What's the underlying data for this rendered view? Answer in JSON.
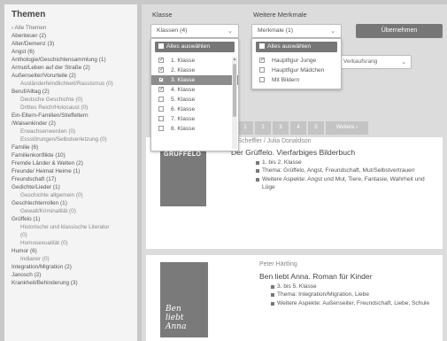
{
  "sidebar": {
    "title": "Themen",
    "items": [
      {
        "label": "› Alle Themen",
        "level": "root"
      },
      {
        "label": "Abenteuer (2)",
        "level": "top"
      },
      {
        "label": "Alter/Demenz (3)",
        "level": "top"
      },
      {
        "label": "Angst (6)",
        "level": "top"
      },
      {
        "label": "Anthologie/Geschichtensammlung (1)",
        "level": "top"
      },
      {
        "label": "Armut/Leben auf der Straße (2)",
        "level": "top"
      },
      {
        "label": "Außenseiter/Vorurteile (2)",
        "level": "top"
      },
      {
        "label": "Ausländerfeindlichkeit/Rassismus (0)",
        "level": "sub"
      },
      {
        "label": "Beruf/Alltag (2)",
        "level": "top"
      },
      {
        "label": "Deutsche Geschichte (0)",
        "level": "sub"
      },
      {
        "label": "Drittes Reich/Holocaust (0)",
        "level": "sub"
      },
      {
        "label": "Ein-Eltern-Familien/Stieffeltern",
        "level": "top"
      },
      {
        "label": "/Waisenkinder (2)",
        "level": "top"
      },
      {
        "label": "Erwachsenwerden (0)",
        "level": "sub"
      },
      {
        "label": "Essstörungen/Selbstverletzung (0)",
        "level": "sub"
      },
      {
        "label": "Familie (6)",
        "level": "top"
      },
      {
        "label": "Familienkonflikte (10)",
        "level": "top"
      },
      {
        "label": "Fremde Länder & Welten (2)",
        "level": "top"
      },
      {
        "label": "Freunde/ Heimat Heime (1)",
        "level": "top"
      },
      {
        "label": "Freundschaft (17)",
        "level": "top"
      },
      {
        "label": "Gedichte/Lieder (1)",
        "level": "top"
      },
      {
        "label": "Geschichte allgemein (0)",
        "level": "sub"
      },
      {
        "label": "Geschlechterrollen (1)",
        "level": "top"
      },
      {
        "label": "Gewalt/Kriminalität (0)",
        "level": "sub"
      },
      {
        "label": "Grüffelo (1)",
        "level": "top"
      },
      {
        "label": "Historische und klassische Literatur",
        "level": "sub"
      },
      {
        "label": "(0)",
        "level": "sub"
      },
      {
        "label": "Homosexualität (0)",
        "level": "sub"
      },
      {
        "label": "Humor (6)",
        "level": "top"
      },
      {
        "label": "Indianer (0)",
        "level": "sub"
      },
      {
        "label": "Integration/Migration (2)",
        "level": "top"
      },
      {
        "label": "Janosch (2)",
        "level": "top"
      },
      {
        "label": "Krankheit/Behinderung (3)",
        "level": "top"
      }
    ]
  },
  "filters": {
    "klasse_label": "Klasse",
    "klasse_value": "Klassen (4)",
    "merkmale_label": "Weitere Merkmale",
    "merkmale_value": "Merkmale (1)",
    "apply_label": "Übernehmen",
    "select_all": "Alles auswählen",
    "klasse_options": [
      {
        "label": "1. Klasse",
        "checked": true,
        "highlighted": false
      },
      {
        "label": "2. Klasse",
        "checked": true,
        "highlighted": false
      },
      {
        "label": "3. Klasse",
        "checked": true,
        "highlighted": true
      },
      {
        "label": "4. Klasse",
        "checked": true,
        "highlighted": false
      },
      {
        "label": "5. Klasse",
        "checked": false,
        "highlighted": false
      },
      {
        "label": "6. Klasse",
        "checked": false,
        "highlighted": false
      },
      {
        "label": "7. Klasse",
        "checked": false,
        "highlighted": false
      },
      {
        "label": "8. Klasse",
        "checked": false,
        "highlighted": false
      }
    ],
    "merkmale_options": [
      {
        "label": "Hauptfigur Junge",
        "checked": true
      },
      {
        "label": "Hauptfigur Mädchen",
        "checked": false
      },
      {
        "label": "Mit Bildern",
        "checked": false
      }
    ],
    "sort_value": "Verkaufsrang"
  },
  "pagination": [
    "1",
    "2",
    "3",
    "4",
    "5",
    "Weitere ›"
  ],
  "books": [
    {
      "author": "el Scheffler / Julia Donaldson",
      "title": "Der Grüffelo. Vierfarbiges Bilderbuch",
      "cover_text": "GRÜFFELO",
      "bullets": [
        "1. bis 2. Klasse",
        "Thema: Grüffelo, Angst, Freundschaft, Mut/Selbstvertrauen",
        "Weitere Aspekte: Angst und Mut, Tiere, Fantasie, Wahrheit und Lüge"
      ]
    },
    {
      "author": "Peter Härtling",
      "title": "Ben liebt Anna. Roman für Kinder",
      "cover_text": "Ben liebt Anna",
      "bullets": [
        "3. bis 5. Klasse",
        "Thema: Integration/Migration, Liebe",
        "Weitere Aspekte: Außenseiter, Freundschaft, Liebe, Schule"
      ]
    }
  ]
}
